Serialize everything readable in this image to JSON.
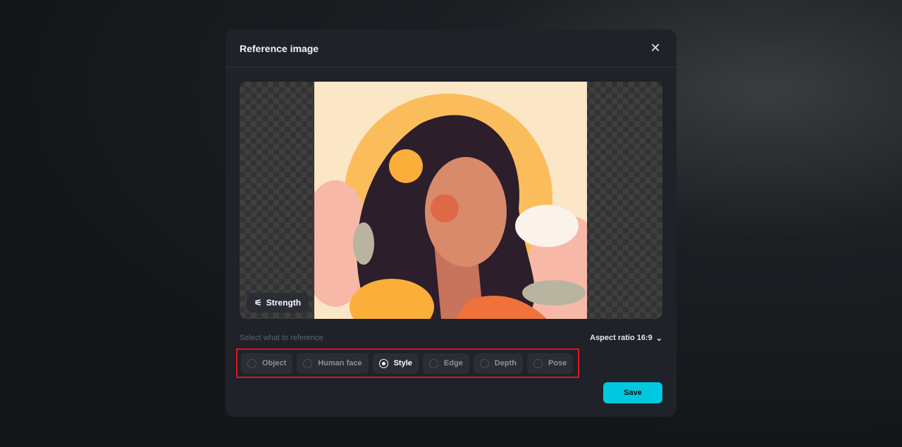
{
  "dialog": {
    "title": "Reference image",
    "close_icon": "close-icon"
  },
  "preview": {
    "strength_label": "Strength",
    "strength_icon": "sliders-icon"
  },
  "reference": {
    "label": "Select what to reference",
    "aspect_ratio": "Aspect ratio 16:9",
    "options": [
      {
        "label": "Object",
        "selected": false
      },
      {
        "label": "Human face",
        "selected": false
      },
      {
        "label": "Style",
        "selected": true
      },
      {
        "label": "Edge",
        "selected": false
      },
      {
        "label": "Depth",
        "selected": false
      },
      {
        "label": "Pose",
        "selected": false
      }
    ]
  },
  "actions": {
    "save": "Save"
  },
  "colors": {
    "accent": "#00c8e0",
    "highlight": "#e0141e"
  }
}
